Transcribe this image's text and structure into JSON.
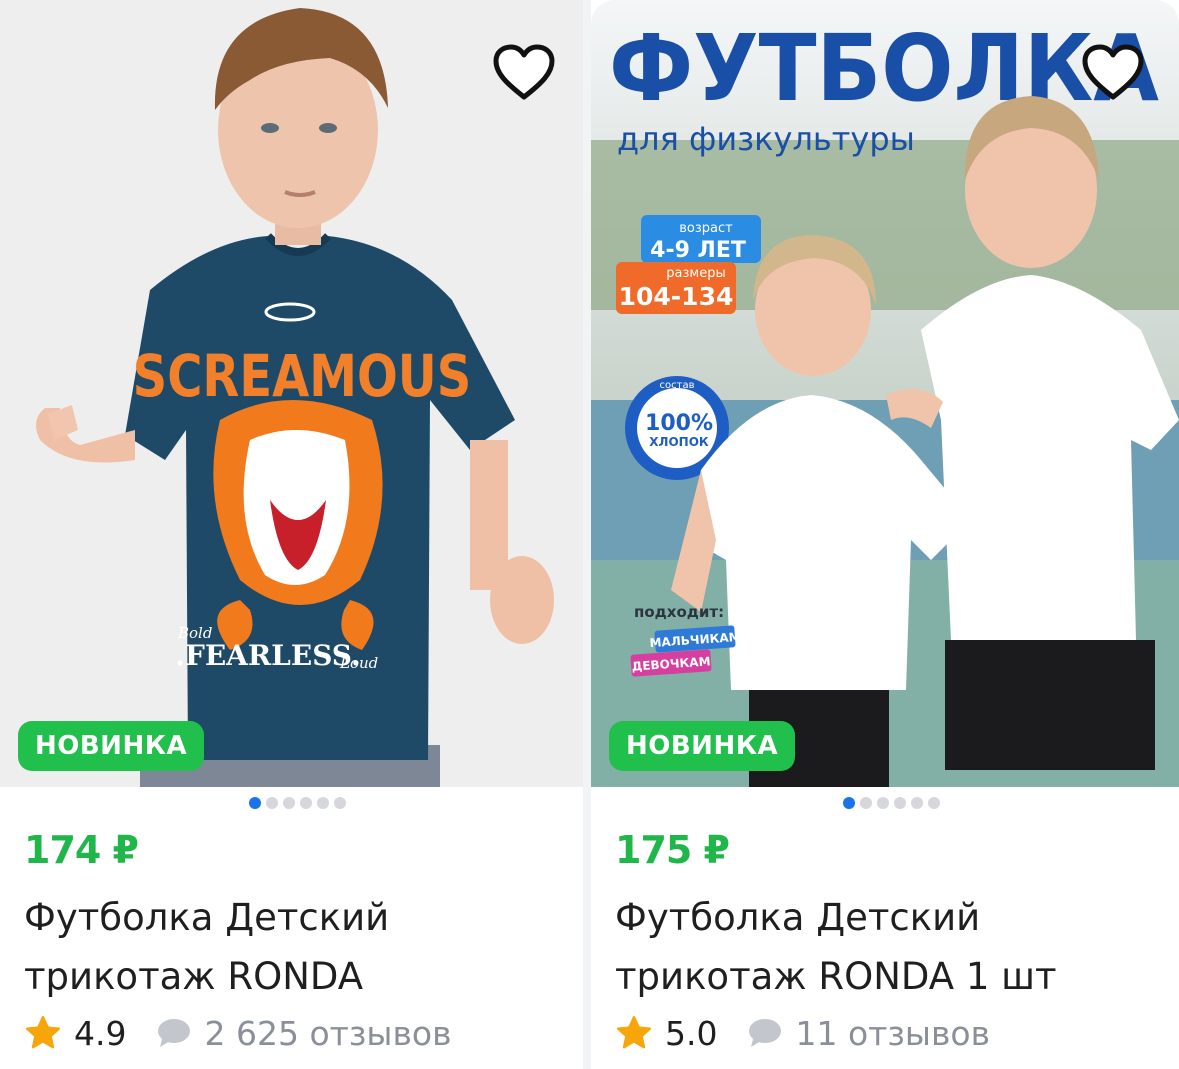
{
  "products": [
    {
      "badge": "НОВИНКА",
      "price": "174 ₽",
      "title_line1": "Футболка Детский",
      "title_line2": "трикотаж RONDA",
      "rating": "4.9",
      "reviews": "2 625 отзывов",
      "photo_print": {
        "top_text": "SCREAMOUS",
        "bottom_text": ".FEARLESS.",
        "left_small": "Bold",
        "right_small": "Loud"
      },
      "dots_count": 6,
      "active_dot": 0
    },
    {
      "badge": "НОВИНКА",
      "price": "175 ₽",
      "title_line1": "Футболка Детский",
      "title_line2": "трикотаж RONDA 1 шт",
      "rating": "5.0",
      "reviews": "11 отзывов",
      "photo_print": {
        "headline": "ФУТБОЛКА",
        "subhead": "для физкультуры",
        "age_label": "возраст",
        "age_value": "4-9 ЛЕТ",
        "size_label": "размеры",
        "size_value": "104-134",
        "cotton_percent": "100%",
        "cotton_label": "ХЛОПОК",
        "cotton_ring": "состав",
        "fits_label": "подходит:",
        "fits_boys": "МАЛЬЧИКАМ",
        "fits_girls": "ДЕВОЧКАМ"
      },
      "dots_count": 6,
      "active_dot": 0
    }
  ],
  "colors": {
    "price": "#21b64a",
    "badge": "#21c04c",
    "dot_active": "#1a73e8",
    "star": "#f6a609",
    "headline_blue": "#1a4fa8"
  },
  "icons": [
    "heart-outline-icon",
    "star-icon",
    "comment-bubble-icon"
  ]
}
